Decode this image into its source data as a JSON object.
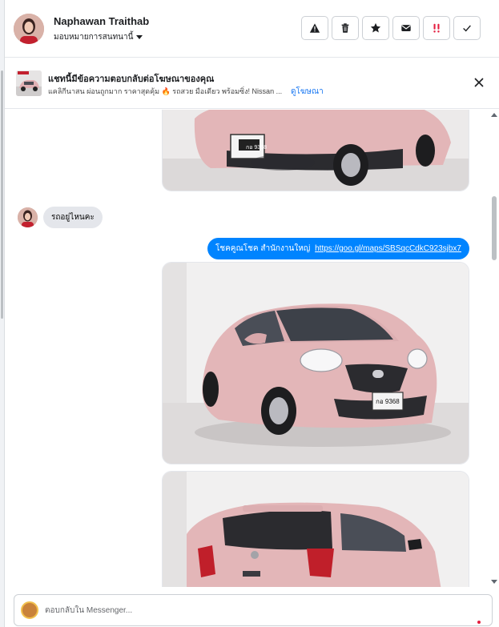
{
  "header": {
    "contact_name": "Naphawan Traithab",
    "assign_label": "มอบหมายการสนทนานี้",
    "actions": [
      {
        "name": "report-icon"
      },
      {
        "name": "trash-icon"
      },
      {
        "name": "star-icon"
      },
      {
        "name": "mail-icon"
      },
      {
        "name": "follow-up-icon"
      },
      {
        "name": "check-icon"
      }
    ]
  },
  "ad_banner": {
    "title": "แชทนี้มีข้อความตอบกลับต่อโฆษณาของคุณ",
    "subtitle": "แคลิกีนาสน ผ่อนถูกมาก ราคาสุดคุ้ม 🔥 รถสวย มือเดียว พร้อมซิ่ง! Nissan ...",
    "link_label": "ดูโฆษณา"
  },
  "messages": {
    "incoming_text": "รถอยู่ไหนคะ",
    "outgoing_text": "โชคคูณโชค สำนักงานใหญ่",
    "outgoing_link": "https://goo.gl/maps/SBSqcCdkC923sjbx7",
    "plate_text": "กอ 9368"
  },
  "composer": {
    "placeholder": "ตอบกลับใน Messenger..."
  },
  "colors": {
    "accent": "#0084ff",
    "link": "#1877f2",
    "car_pink": "#e0b0b3"
  }
}
